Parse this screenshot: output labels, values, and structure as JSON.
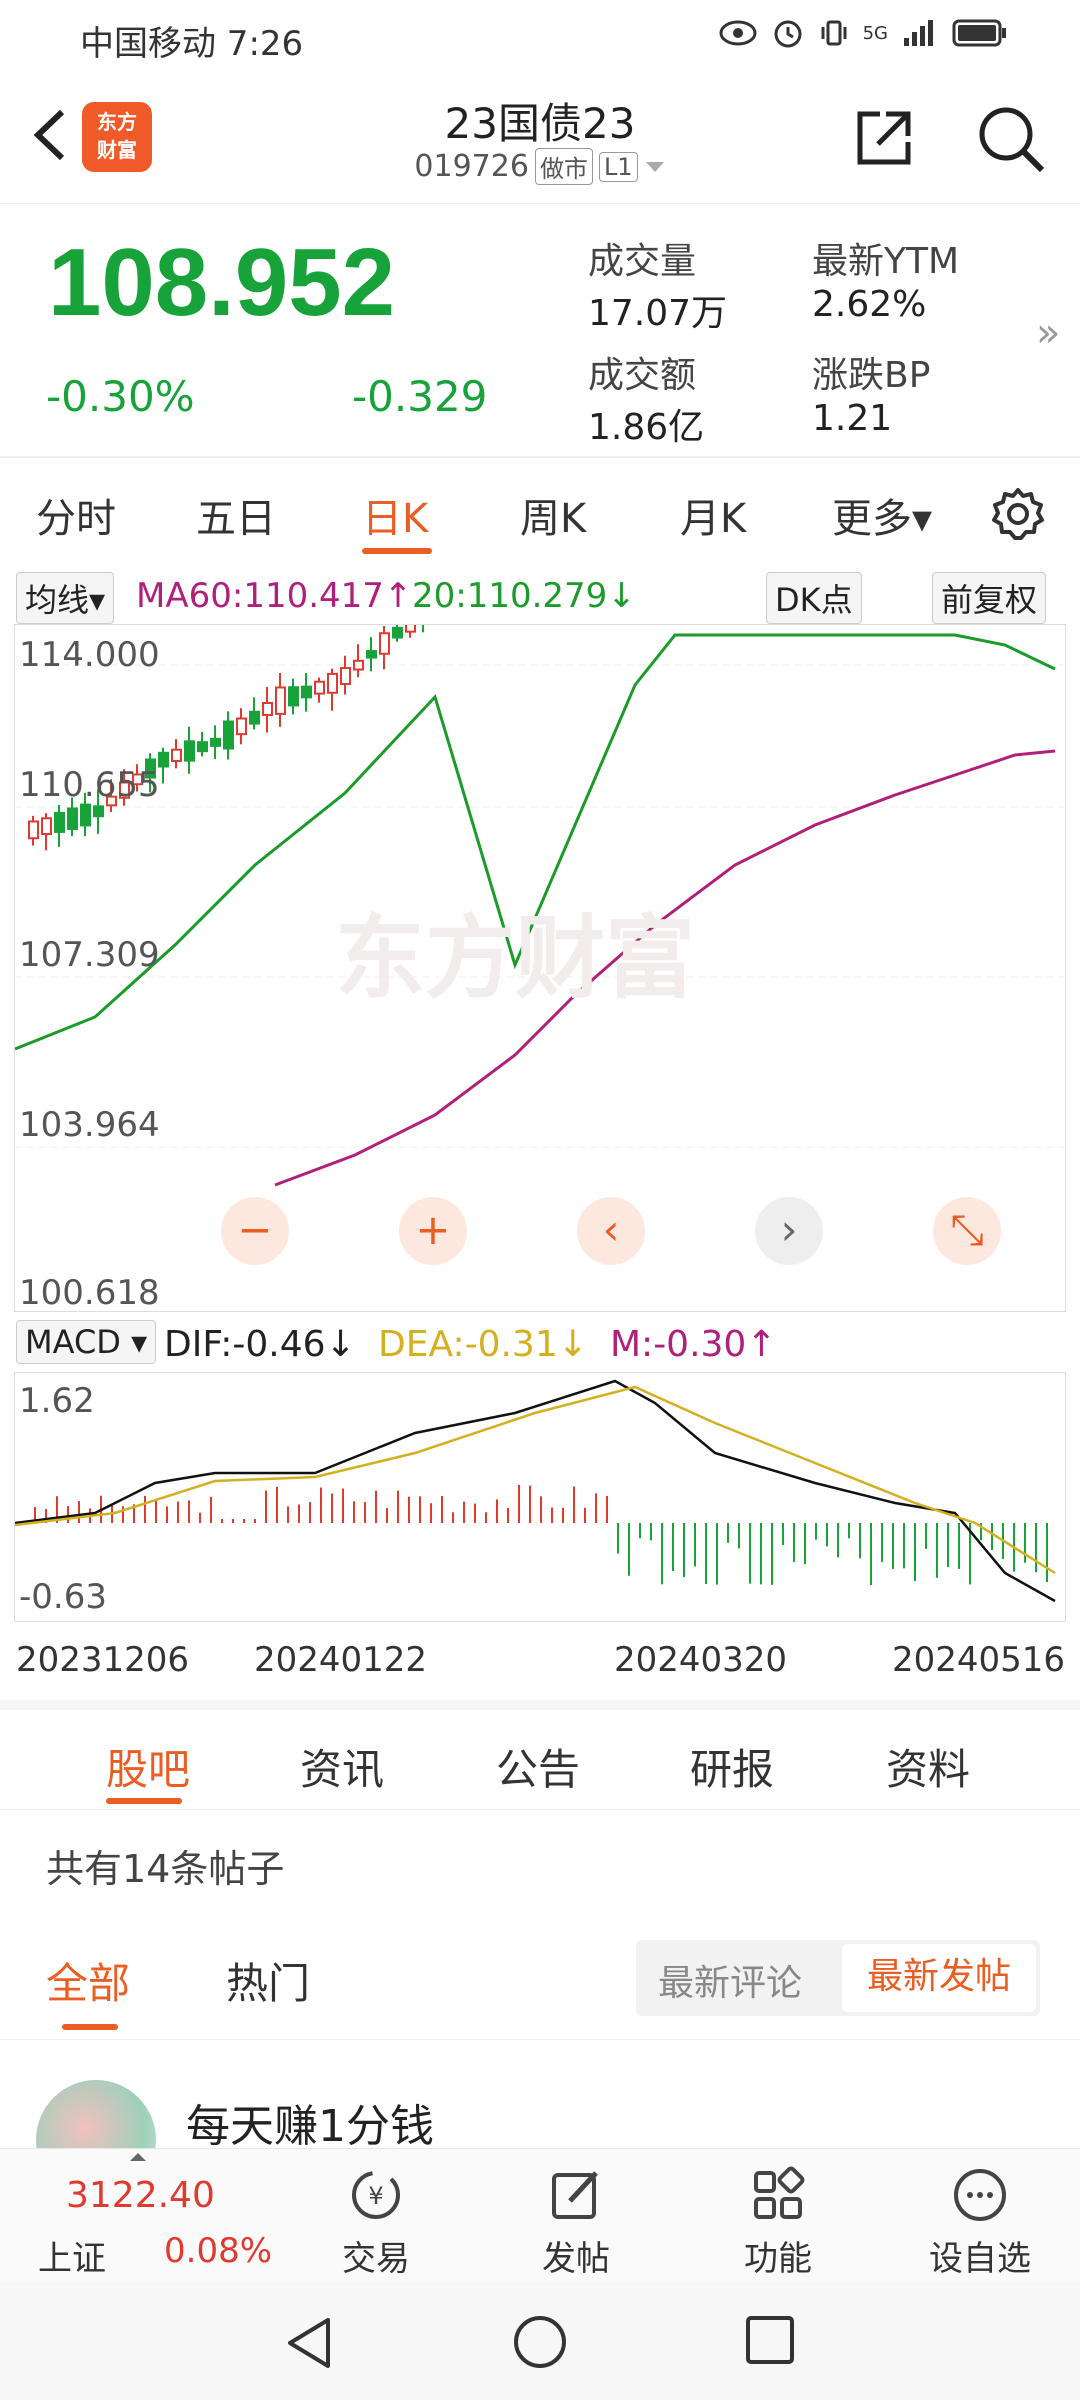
{
  "status_bar": {
    "carrier_time": "中国移动 7:26",
    "network": "5G"
  },
  "header": {
    "title": "23国债23",
    "code": "019726",
    "tag1": "做市",
    "tag2": "L1",
    "logo": "东方\n财富"
  },
  "quote": {
    "price": "108.952",
    "change_pct": "-0.30%",
    "change": "-0.329",
    "stats": [
      {
        "label": "成交量",
        "value": "17.07万"
      },
      {
        "label": "最新YTM",
        "value": "2.62%"
      },
      {
        "label": "成交额",
        "value": "1.86亿"
      },
      {
        "label": "涨跌BP",
        "value": "1.21"
      }
    ],
    "up_color": "#e03a2f",
    "down_color": "#18a23a"
  },
  "periods": [
    "分时",
    "五日",
    "日K",
    "周K",
    "月K",
    "更多▾"
  ],
  "active_period": "日K",
  "ma_bar": {
    "selector": "均线▾",
    "ma60": "MA60:110.417↑",
    "ma20": "20:110.279↓",
    "dk": "DK点",
    "fq": "前复权"
  },
  "kline_axis": {
    "y_labels": [
      "114.000",
      "110.655",
      "107.309",
      "103.964",
      "100.618"
    ]
  },
  "controls": [
    "−",
    "+",
    "‹",
    "›",
    "⤡"
  ],
  "macd_bar": {
    "selector": "MACD ▾",
    "dif": "DIF:-0.46↓",
    "dea": "DEA:-0.31↓",
    "m": "M:-0.30↑"
  },
  "macd_axis": {
    "top": "1.62",
    "bottom": "-0.63"
  },
  "dates": [
    "20231206",
    "20240122",
    "20240320",
    "20240516"
  ],
  "content_tabs": [
    "股吧",
    "资讯",
    "公告",
    "研报",
    "资料"
  ],
  "post_count": "共有14条帖子",
  "filters": {
    "all": "全部",
    "hot": "热门",
    "latest_comment": "最新评论",
    "latest_post": "最新发帖"
  },
  "post": {
    "author": "每天赚1分钱"
  },
  "bottom_nav": {
    "index_value": "3122.40",
    "index_name": "上证",
    "index_pct": "0.08%",
    "items": [
      "交易",
      "发帖",
      "功能",
      "设自选"
    ]
  }
}
